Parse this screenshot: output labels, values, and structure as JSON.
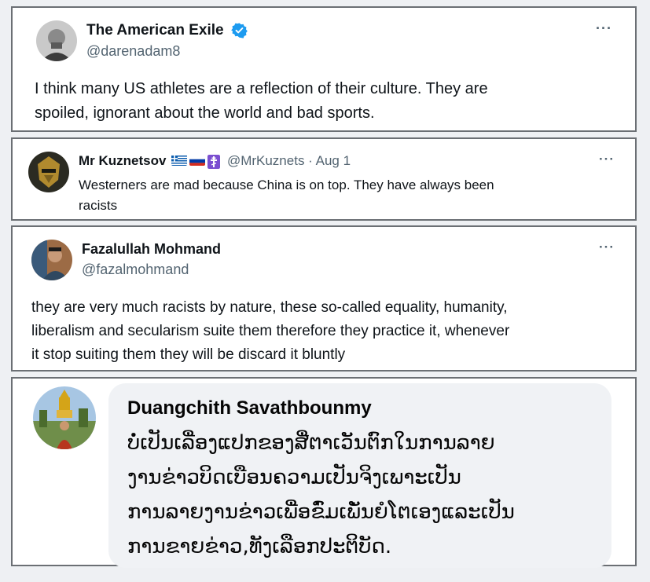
{
  "posts": [
    {
      "display_name": "The American Exile",
      "handle": "@darenadam8",
      "verified": true,
      "more": "···",
      "text_lines": [
        "I think many US athletes are a reflection of their culture. They are",
        "spoiled, ignorant about the world and bad sports."
      ]
    },
    {
      "display_name": "Mr Kuznetsov",
      "flags": [
        "greece-flag",
        "russia-flag",
        "orthodox-cross-flag"
      ],
      "handle_meta": "@MrKuznets · Aug 1",
      "more": "···",
      "text_lines": [
        "Westerners are mad because China is on top. They have always been",
        "racists"
      ]
    },
    {
      "display_name": "Fazalullah Mohmand",
      "handle": "@fazalmohmand",
      "more": "···",
      "text_lines": [
        "they are very much racists by nature, these so-called equality, humanity,",
        "liberalism and secularism suite them therefore they practice it, whenever",
        "it stop suiting them they will be discard it bluntly"
      ]
    }
  ],
  "comment": {
    "display_name": "Duangchith Savathbounmy",
    "text_lines": [
      "ບໍ່ເປັນເລື່ອງແປກຂອງສື່ຕາເວັນຕົກໃນການລາຍ",
      "ງານຂ່າວບິດເບືອນຄວາມເປັນຈິງເພາະເປັນ",
      "ການລາຍງານຂ່າວເພື່ອຂົ່ມເພັ່ນຍໍໂຕເອງແລະເປັນ",
      "ການຂາຍຂ່າວ,ທັງເລືອກປະຕິບັດ."
    ]
  },
  "colors": {
    "verified_blue": "#1d9bf0",
    "card_border": "#6b6f74",
    "handle_gray": "#536471",
    "bubble_bg": "#f0f2f5"
  }
}
